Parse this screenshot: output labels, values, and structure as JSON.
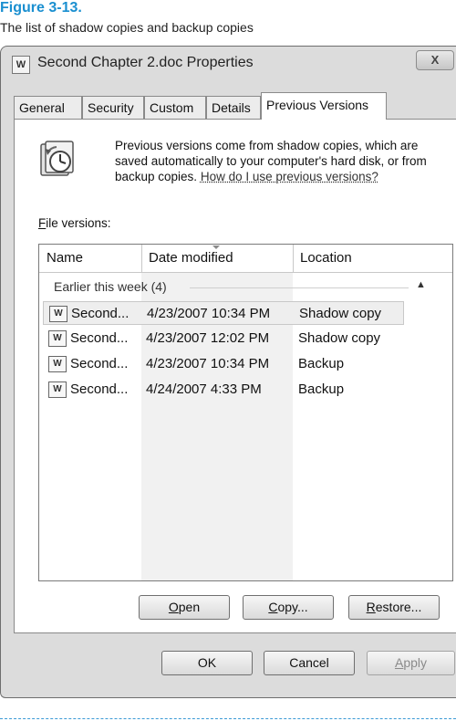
{
  "figure": {
    "title": "Figure 3-13.",
    "caption": "The list of shadow copies and backup copies"
  },
  "window": {
    "title": "Second Chapter 2.doc Properties",
    "close_glyph": "X"
  },
  "tabs": [
    {
      "label": "General",
      "active": false
    },
    {
      "label": "Security",
      "active": false
    },
    {
      "label": "Custom",
      "active": false
    },
    {
      "label": "Details",
      "active": false
    },
    {
      "label": "Previous Versions",
      "active": true
    }
  ],
  "info": {
    "text": "Previous versions come from shadow copies, which are saved automatically to your computer's hard disk, or from backup copies.",
    "link": "How do I use previous versions?"
  },
  "file_versions": {
    "label_accel": "F",
    "label_rest": "ile versions:",
    "columns": {
      "name": "Name",
      "date": "Date modified",
      "location": "Location"
    },
    "group": {
      "label": "Earlier this week (4)",
      "chevron": "▲"
    },
    "rows": [
      {
        "name": "Second...",
        "date": "4/23/2007 10:34 PM",
        "location": "Shadow copy"
      },
      {
        "name": "Second...",
        "date": "4/23/2007 12:02 PM",
        "location": "Shadow copy"
      },
      {
        "name": "Second...",
        "date": "4/23/2007 10:34 PM",
        "location": "Backup"
      },
      {
        "name": "Second...",
        "date": "4/24/2007 4:33 PM",
        "location": "Backup"
      }
    ]
  },
  "actions": {
    "open": {
      "accel": "O",
      "rest": "pen"
    },
    "copy": {
      "accel": "C",
      "rest": "opy..."
    },
    "restore": {
      "accel": "R",
      "rest": "estore..."
    }
  },
  "dialog_buttons": {
    "ok": "OK",
    "cancel": "Cancel",
    "apply": {
      "accel": "A",
      "rest": "pply"
    }
  }
}
